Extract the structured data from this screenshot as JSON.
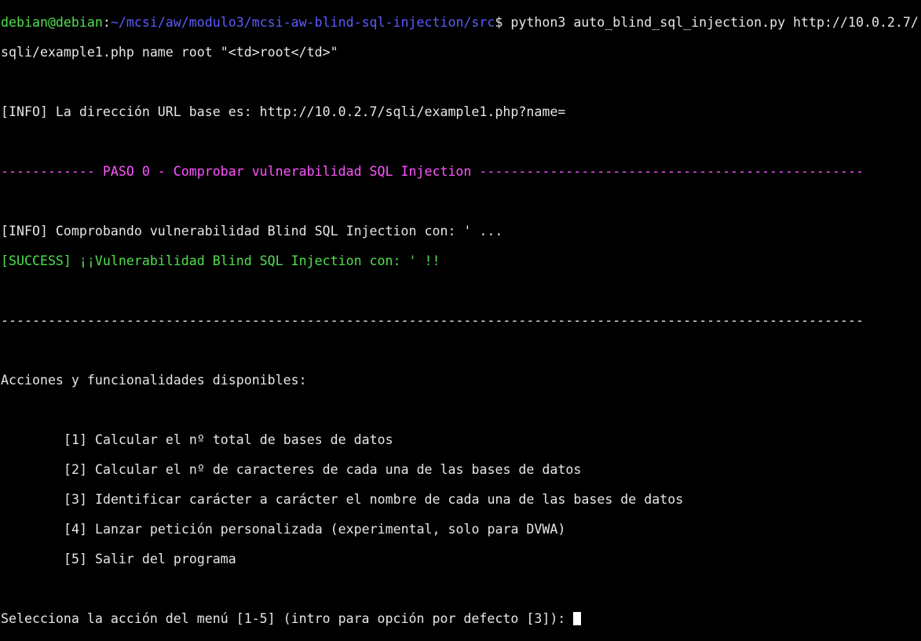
{
  "prompt": {
    "user_host": "debian@debian",
    "separator": ":",
    "path": "~/mcsi/aw/modulo3/mcsi-aw-blind-sql-injection/src",
    "symbol": "$",
    "command_line1": " python3 auto_blind_sql_injection.py http://10.0.2.7/",
    "command_line2": "sqli/example1.php name root \"<td>root</td>\""
  },
  "output": {
    "info_base_url": "[INFO] La dirección URL base es: http://10.0.2.7/sqli/example1.php?name=",
    "step_header": "------------ PASO 0 - Comprobar vulnerabilidad SQL Injection -------------------------------------------------",
    "info_checking": "[INFO] Comprobando vulnerabilidad Blind SQL Injection con: ' ...",
    "success": "[SUCCESS] ¡¡Vulnerabilidad Blind SQL Injection con: ' !!",
    "divider": "--------------------------------------------------------------------------------------------------------------",
    "menu_title": "Acciones y funcionalidades disponibles:",
    "menu_items": [
      "[1] Calcular el nº total de bases de datos",
      "[2] Calcular el nº de caracteres de cada una de las bases de datos",
      "[3] Identificar carácter a carácter el nombre de cada una de las bases de datos",
      "[4] Lanzar petición personalizada (experimental, solo para DVWA)",
      "[5] Salir del programa"
    ],
    "input_prompt": "Selecciona la acción del menú [1-5] (intro para opción por defecto [3]): "
  },
  "colors": {
    "prompt_user": "#4fe04f",
    "prompt_path": "#5b5bff",
    "step_header": "#ff55ff",
    "success": "#4fe04f",
    "background": "#000000"
  }
}
